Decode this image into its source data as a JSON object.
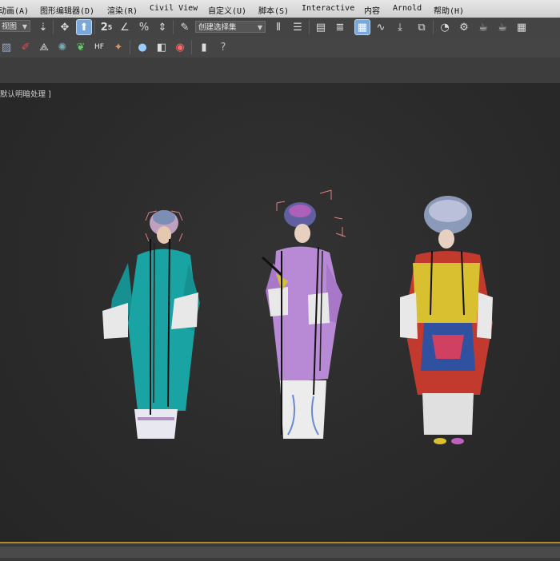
{
  "menubar": {
    "items": [
      {
        "label": "动画(A)"
      },
      {
        "label": "图形编辑器(D)"
      },
      {
        "label": "渲染(R)"
      },
      {
        "label": "Civil View"
      },
      {
        "label": "自定义(U)"
      },
      {
        "label": "脚本(S)"
      },
      {
        "label": "Interactive"
      },
      {
        "label": "内容"
      },
      {
        "label": "Arnold"
      },
      {
        "label": "帮助(H)"
      }
    ]
  },
  "toolbar": {
    "view_dropdown": "视图",
    "selection_set_dropdown": "创建选择集"
  },
  "viewport": {
    "label": "默认明暗处理 ]"
  },
  "colors": {
    "teal_dress": "#1aa3a3",
    "lilac_dress": "#b88ad6",
    "bride_robe_red": "#c23a2e",
    "bride_gold": "#d8c030",
    "selection_bracket": "#e08080",
    "timeline_accent": "#b08a2a"
  }
}
